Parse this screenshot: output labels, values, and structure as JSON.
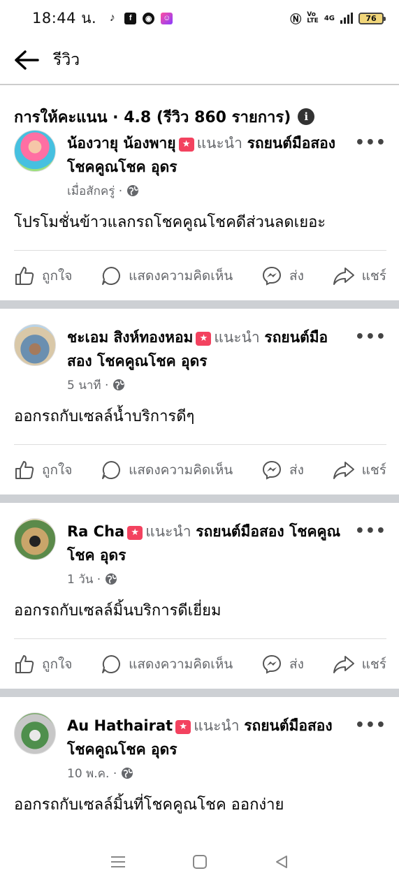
{
  "status_bar": {
    "time": "18:44 น.",
    "battery": "76",
    "net": "4G"
  },
  "header": {
    "title": "รีวิว"
  },
  "rating_summary": "การให้คะแนน · 4.8 (รีวิว 860 รายการ)",
  "reviews": [
    {
      "name": "น้องวายุ น้องพายุ",
      "recommends": "แนะนำ",
      "page": "รถยนต์มือสอง โชคคูณโชค อุดร",
      "time": "เมื่อสักครู่ ·",
      "text": "โปรโมชั่นข้าวแลกรถโชคคูณโชคดีส่วนลดเยอะ"
    },
    {
      "name": "ชะเอม สิงห์ทองหอม",
      "recommends": "แนะนำ",
      "page": "รถยนต์มือสอง โชคคูณโชค อุดร",
      "time": "5 นาที ·",
      "text": "ออกรถกับเซลล์น้ำบริการดีๆ"
    },
    {
      "name": "Ra Cha",
      "recommends": "แนะนำ",
      "page": "รถยนต์มือสอง โชคคูณโชค อุดร",
      "time": "1 วัน ·",
      "text": "ออกรถกับเซลล์มิ้นบริการดีเยี่ยม"
    },
    {
      "name": "Au Hathairat",
      "recommends": "แนะนำ",
      "page": "รถยนต์มือสอง โชคคูณโชค อุดร",
      "time": "10 พ.ค. ·",
      "text": "ออกรถกับเซลล์มิ้นที่โชคคูณโชค ออกง่าย"
    }
  ],
  "actions": {
    "like": "ถูกใจ",
    "comment": "แสดงความคิดเห็น",
    "send": "ส่ง",
    "share": "แชร์"
  },
  "colors": {
    "recommend_badge": "#f3425f",
    "separator": "#cdd0d4",
    "muted_text": "#65676b"
  }
}
